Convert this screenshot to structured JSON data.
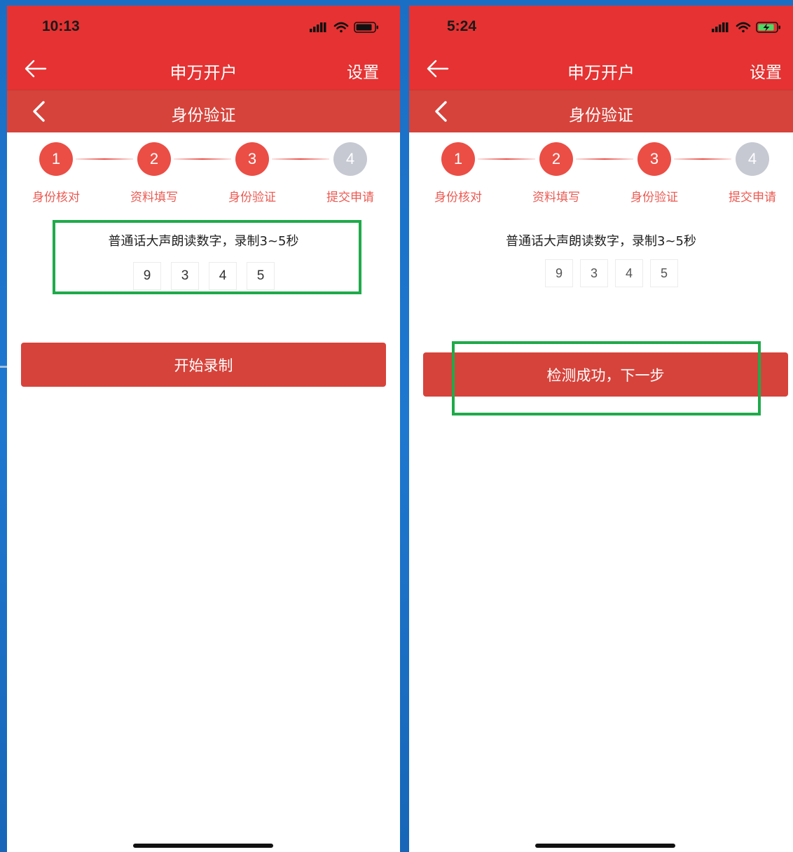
{
  "colors": {
    "primary_red": "#e63232",
    "sub_bar_red": "#d6433b",
    "step_active": "#eb4e45",
    "step_inactive": "#c6c9d2",
    "highlight_green": "#1faa4a",
    "background_blue": "#1e78cf"
  },
  "left_screen": {
    "status": {
      "time": "10:13",
      "icons": [
        "cellular-signal-icon",
        "wifi-icon",
        "battery-icon"
      ]
    },
    "nav": {
      "back_icon": "arrow-left-icon",
      "title": "申万开户",
      "settings": "设置"
    },
    "sub_nav": {
      "back_icon": "chevron-left-icon",
      "title": "身份验证"
    },
    "steps": [
      {
        "number": "1",
        "label": "身份核对",
        "state": "active"
      },
      {
        "number": "2",
        "label": "资料填写",
        "state": "active"
      },
      {
        "number": "3",
        "label": "身份验证",
        "state": "active"
      },
      {
        "number": "4",
        "label": "提交申请",
        "state": "inactive"
      }
    ],
    "instruction": "普通话大声朗读数字，录制3~5秒",
    "digits": [
      "9",
      "3",
      "4",
      "5"
    ],
    "button_label": "开始录制"
  },
  "right_screen": {
    "status": {
      "time": "5:24",
      "icons": [
        "cellular-signal-icon",
        "wifi-icon",
        "battery-charging-icon"
      ]
    },
    "nav": {
      "back_icon": "arrow-left-icon",
      "title": "申万开户",
      "settings": "设置"
    },
    "sub_nav": {
      "back_icon": "chevron-left-icon",
      "title": "身份验证"
    },
    "steps": [
      {
        "number": "1",
        "label": "身份核对",
        "state": "active"
      },
      {
        "number": "2",
        "label": "资料填写",
        "state": "active"
      },
      {
        "number": "3",
        "label": "身份验证",
        "state": "active"
      },
      {
        "number": "4",
        "label": "提交申请",
        "state": "inactive"
      }
    ],
    "instruction": "普通话大声朗读数字，录制3~5秒",
    "digits": [
      "9",
      "3",
      "4",
      "5"
    ],
    "button_label": "检测成功，下一步"
  }
}
